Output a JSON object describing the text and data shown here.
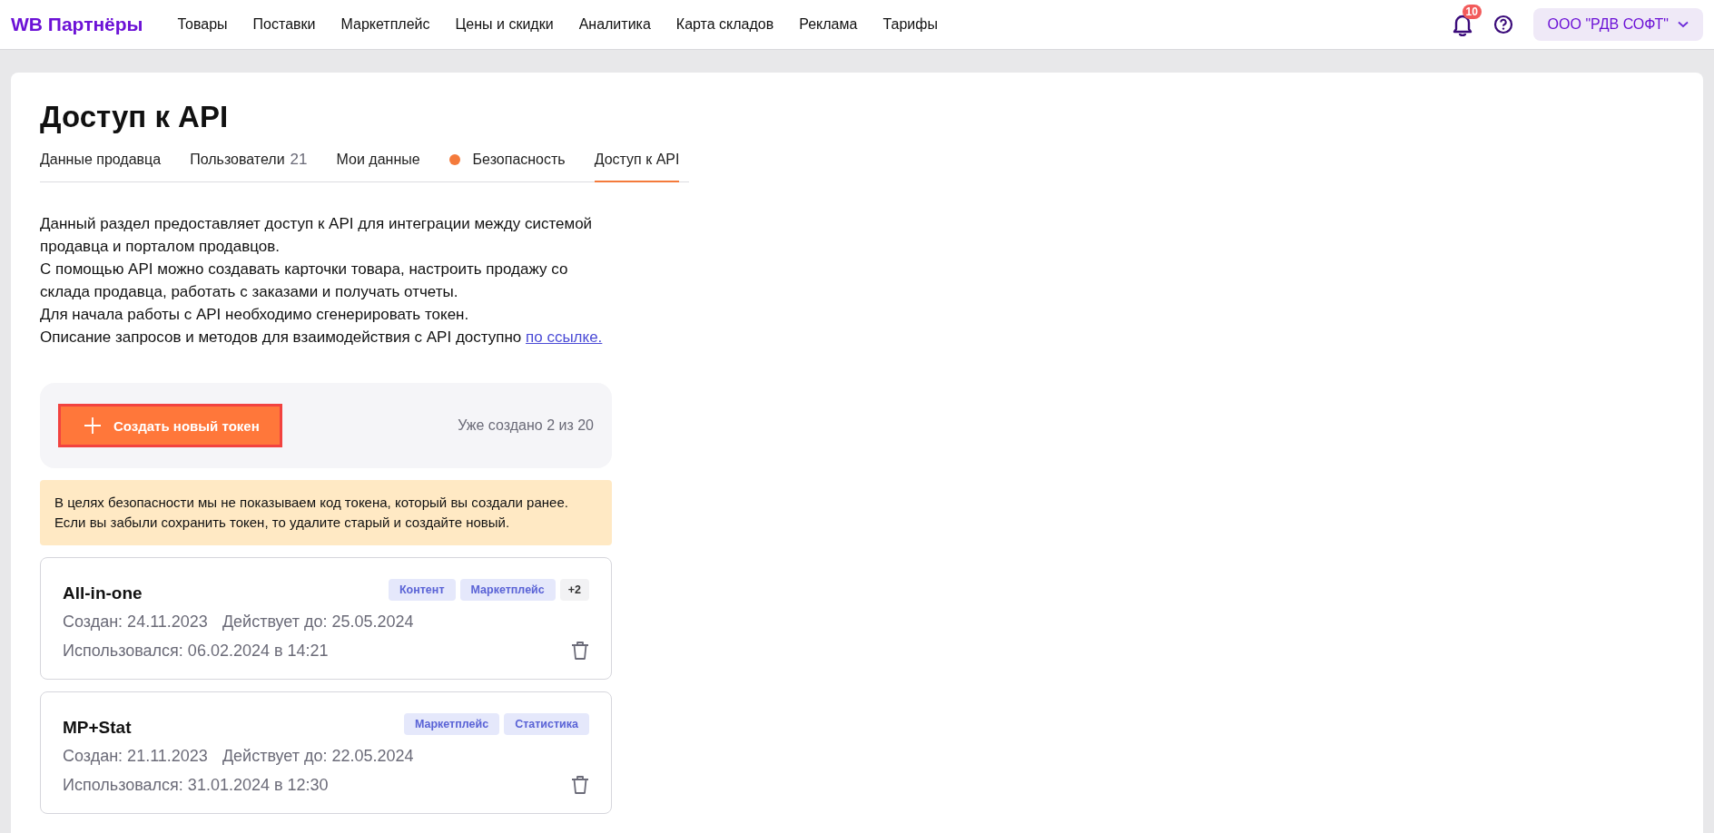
{
  "header": {
    "logo": "WB Партнёры",
    "nav": [
      {
        "label": "Товары"
      },
      {
        "label": "Поставки"
      },
      {
        "label": "Маркетплейс"
      },
      {
        "label": "Цены и скидки"
      },
      {
        "label": "Аналитика"
      },
      {
        "label": "Карта складов"
      },
      {
        "label": "Реклама"
      },
      {
        "label": "Тарифы"
      }
    ],
    "notifications_badge": "10",
    "account": "ООО \"РДВ СОФТ\""
  },
  "page": {
    "title": "Доступ к API",
    "tabs": [
      {
        "label": "Данные продавца",
        "selected": false
      },
      {
        "label": "Пользователи",
        "count": "21",
        "selected": false
      },
      {
        "label": "Мои данные",
        "selected": false
      },
      {
        "label": "Безопасность",
        "alert": true,
        "selected": false
      },
      {
        "label": "Доступ к API",
        "selected": true
      }
    ],
    "description": [
      "Данный раздел предоставляет доступ к API для интеграции между системой продавца и порталом продавцов.",
      "С помощью API можно создавать карточки товара, настроить продажу со склада продавца, работать с заказами и получать отчеты.",
      "Для начала работы с API необходимо сгенерировать токен."
    ],
    "description_last": {
      "text": "Описание запросов и методов для взаимодействия с API доступно",
      "link": "по ссылке."
    },
    "create_button": "Создать новый токен",
    "created_count": "Уже создано 2 из 20",
    "warning": "В целях безопасности мы не показываем код токена, который вы создали ранее. Если вы забыли сохранить токен, то удалите старый и создайте новый.",
    "tokens": [
      {
        "name": "All-in-one",
        "tags": [
          {
            "label": "Контент",
            "kind": "scope"
          },
          {
            "label": "Маркетплейс",
            "kind": "scope"
          },
          {
            "label": "+2",
            "kind": "more"
          }
        ],
        "created": "Создан: 24.11.2023",
        "expires": "Действует до: 25.05.2024",
        "used": "Использовался: 06.02.2024 в 14:21"
      },
      {
        "name": "MP+Stat",
        "tags": [
          {
            "label": "Маркетплейс",
            "kind": "scope"
          },
          {
            "label": "Статистика",
            "kind": "scope"
          }
        ],
        "created": "Создан: 21.11.2023",
        "expires": "Действует до: 22.05.2024",
        "used": "Использовался: 31.01.2024 в 12:30"
      }
    ]
  }
}
